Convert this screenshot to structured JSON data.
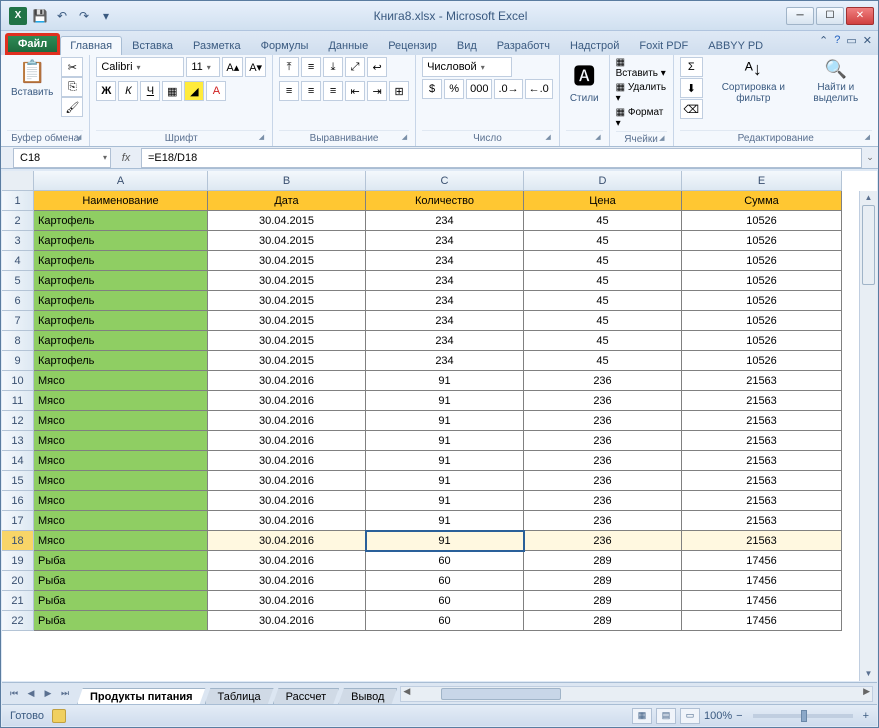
{
  "app_title": "Книга8.xlsx - Microsoft Excel",
  "qat": {
    "save": "💾",
    "undo": "↶",
    "redo": "↷"
  },
  "tabs": {
    "file": "Файл",
    "home": "Главная",
    "insert": "Вставка",
    "layout": "Разметка",
    "formulas": "Формулы",
    "data": "Данные",
    "review": "Рецензир",
    "view": "Вид",
    "developer": "Разработч",
    "addins": "Надстрой",
    "foxit": "Foxit PDF",
    "abbyy": "ABBYY PD"
  },
  "ribbon": {
    "clipboard": {
      "label": "Буфер обмена",
      "paste": "Вставить"
    },
    "font": {
      "label": "Шрифт",
      "name": "Calibri",
      "size": "11"
    },
    "align": {
      "label": "Выравнивание"
    },
    "number": {
      "label": "Число",
      "format": "Числовой"
    },
    "styles": {
      "label": "",
      "btn": "Стили"
    },
    "cells": {
      "label": "Ячейки",
      "insert": "Вставить",
      "delete": "Удалить",
      "format": "Формат"
    },
    "editing": {
      "label": "Редактирование",
      "sort": "Сортировка и фильтр",
      "find": "Найти и выделить"
    }
  },
  "formula_bar": {
    "name_box": "C18",
    "fx": "fx",
    "formula": "=E18/D18"
  },
  "columns": [
    "A",
    "B",
    "C",
    "D",
    "E"
  ],
  "col_widths": [
    "wA",
    "wB",
    "wC",
    "wD",
    "wE"
  ],
  "headers": [
    "Наименование",
    "Дата",
    "Количество",
    "Цена",
    "Сумма"
  ],
  "rows": [
    {
      "n": 2,
      "c": [
        "Картофель",
        "30.04.2015",
        "234",
        "45",
        "10526"
      ]
    },
    {
      "n": 3,
      "c": [
        "Картофель",
        "30.04.2015",
        "234",
        "45",
        "10526"
      ]
    },
    {
      "n": 4,
      "c": [
        "Картофель",
        "30.04.2015",
        "234",
        "45",
        "10526"
      ]
    },
    {
      "n": 5,
      "c": [
        "Картофель",
        "30.04.2015",
        "234",
        "45",
        "10526"
      ]
    },
    {
      "n": 6,
      "c": [
        "Картофель",
        "30.04.2015",
        "234",
        "45",
        "10526"
      ]
    },
    {
      "n": 7,
      "c": [
        "Картофель",
        "30.04.2015",
        "234",
        "45",
        "10526"
      ]
    },
    {
      "n": 8,
      "c": [
        "Картофель",
        "30.04.2015",
        "234",
        "45",
        "10526"
      ]
    },
    {
      "n": 9,
      "c": [
        "Картофель",
        "30.04.2015",
        "234",
        "45",
        "10526"
      ]
    },
    {
      "n": 10,
      "c": [
        "Мясо",
        "30.04.2016",
        "91",
        "236",
        "21563"
      ]
    },
    {
      "n": 11,
      "c": [
        "Мясо",
        "30.04.2016",
        "91",
        "236",
        "21563"
      ]
    },
    {
      "n": 12,
      "c": [
        "Мясо",
        "30.04.2016",
        "91",
        "236",
        "21563"
      ]
    },
    {
      "n": 13,
      "c": [
        "Мясо",
        "30.04.2016",
        "91",
        "236",
        "21563"
      ]
    },
    {
      "n": 14,
      "c": [
        "Мясо",
        "30.04.2016",
        "91",
        "236",
        "21563"
      ]
    },
    {
      "n": 15,
      "c": [
        "Мясо",
        "30.04.2016",
        "91",
        "236",
        "21563"
      ]
    },
    {
      "n": 16,
      "c": [
        "Мясо",
        "30.04.2016",
        "91",
        "236",
        "21563"
      ]
    },
    {
      "n": 17,
      "c": [
        "Мясо",
        "30.04.2016",
        "91",
        "236",
        "21563"
      ]
    },
    {
      "n": 18,
      "c": [
        "Мясо",
        "30.04.2016",
        "91",
        "236",
        "21563"
      ]
    },
    {
      "n": 19,
      "c": [
        "Рыба",
        "30.04.2016",
        "60",
        "289",
        "17456"
      ]
    },
    {
      "n": 20,
      "c": [
        "Рыба",
        "30.04.2016",
        "60",
        "289",
        "17456"
      ]
    },
    {
      "n": 21,
      "c": [
        "Рыба",
        "30.04.2016",
        "60",
        "289",
        "17456"
      ]
    },
    {
      "n": 22,
      "c": [
        "Рыба",
        "30.04.2016",
        "60",
        "289",
        "17456"
      ]
    }
  ],
  "selected_row": 18,
  "selected_col": 2,
  "sheets": {
    "active": "Продукты питания",
    "others": [
      "Таблица",
      "Рассчет",
      "Вывод"
    ]
  },
  "status": {
    "ready": "Готово",
    "zoom": "100%",
    "minus": "−",
    "plus": "+"
  }
}
